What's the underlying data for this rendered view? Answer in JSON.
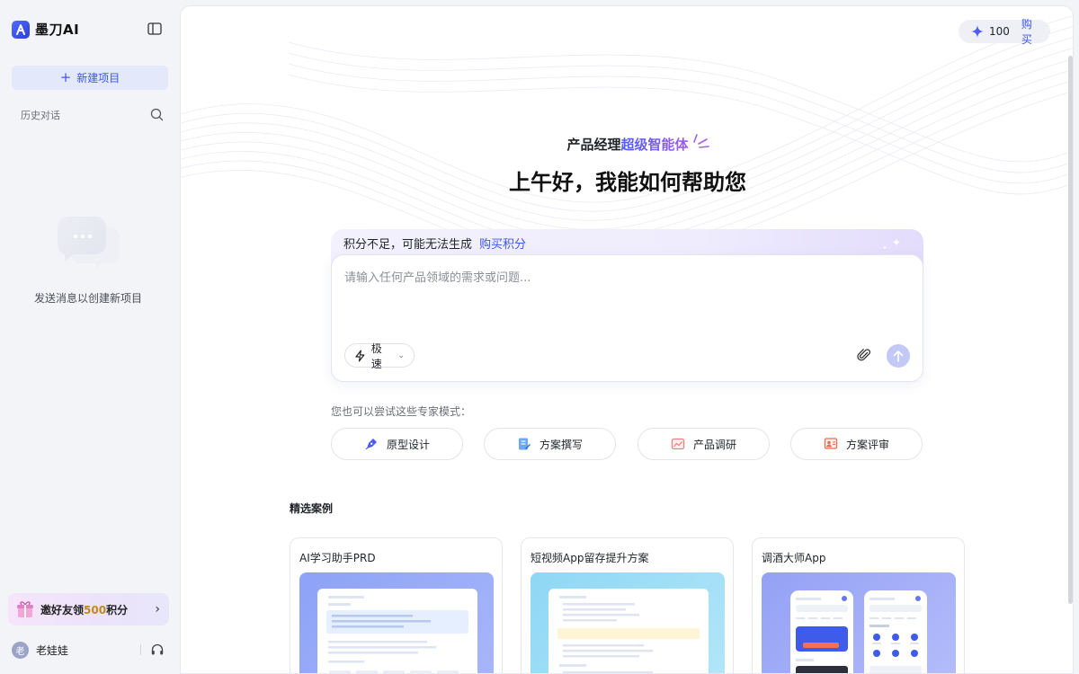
{
  "sidebar": {
    "brand_name": "墨刀AI",
    "new_project_label": "新建项目",
    "history_label": "历史对话",
    "empty_text": "发送消息以创建新项目",
    "invite": {
      "prefix": "邀好友领",
      "amount": "500",
      "suffix": "积分"
    },
    "user": {
      "avatar_text": "老",
      "name": "老娃娃"
    }
  },
  "header": {
    "credits_count": "100",
    "credits_buy_label": "购买"
  },
  "hero": {
    "tagline_prefix": "产品经理",
    "tagline_highlight": "超级智能体",
    "greeting": "上午好，我能如何帮助您"
  },
  "composer": {
    "warning_text": "积分不足，可能无法生成",
    "warning_link": "购买积分",
    "placeholder": "请输入任何产品领域的需求或问题...",
    "mode_label": "极速"
  },
  "experts": {
    "label": "您也可以尝试这些专家模式：",
    "items": [
      {
        "label": "原型设计",
        "icon": "pen-nib-icon",
        "color": "#4a5cf0"
      },
      {
        "label": "方案撰写",
        "icon": "document-edit-icon",
        "color": "#3d8ff0"
      },
      {
        "label": "产品调研",
        "icon": "chart-image-icon",
        "color": "#f07f7f"
      },
      {
        "label": "方案评审",
        "icon": "review-board-icon",
        "color": "#f06a4f"
      }
    ]
  },
  "featured": {
    "title": "精选案例",
    "cases": [
      {
        "title": "AI学习助手PRD"
      },
      {
        "title": "短视频App留存提升方案"
      },
      {
        "title": "调酒大师App"
      }
    ]
  }
}
